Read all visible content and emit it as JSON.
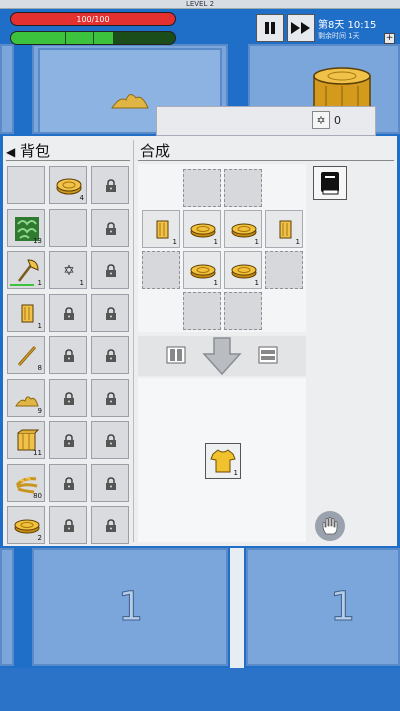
{
  "hud": {
    "level_label": "LEVEL 2",
    "hp_text": "100/100",
    "hp_fraction": 1.0,
    "stamina_fraction": 0.62,
    "day_text": "第8天 10:15",
    "day_sub": "剩余时间 1天",
    "pause_icon": "pause-icon",
    "fast_forward_icon": "fast-forward-icon",
    "plus_label": "+"
  },
  "star_counter": {
    "icon": "star-of-david-icon",
    "value": "0"
  },
  "inventory": {
    "title": "背包",
    "back_icon": "triangle-left-icon",
    "slots": [
      {
        "item": "empty",
        "count": ""
      },
      {
        "item": "log-icon",
        "count": "4"
      },
      {
        "item": "lock-icon",
        "count": ""
      },
      {
        "item": "leaf-bush-icon",
        "count": "13"
      },
      {
        "item": "empty",
        "count": ""
      },
      {
        "item": "lock-icon",
        "count": ""
      },
      {
        "item": "axe-icon",
        "count": "1"
      },
      {
        "item": "star-icon",
        "count": "1"
      },
      {
        "item": "lock-icon",
        "count": ""
      },
      {
        "item": "plank-icon",
        "count": "1"
      },
      {
        "item": "lock-icon",
        "count": ""
      },
      {
        "item": "lock-icon",
        "count": ""
      },
      {
        "item": "stick-icon",
        "count": "8"
      },
      {
        "item": "lock-icon",
        "count": ""
      },
      {
        "item": "lock-icon",
        "count": ""
      },
      {
        "item": "sawdust-icon",
        "count": "9"
      },
      {
        "item": "lock-icon",
        "count": ""
      },
      {
        "item": "lock-icon",
        "count": ""
      },
      {
        "item": "crate-icon",
        "count": "11"
      },
      {
        "item": "lock-icon",
        "count": ""
      },
      {
        "item": "lock-icon",
        "count": ""
      },
      {
        "item": "wheat-icon",
        "count": "80"
      },
      {
        "item": "lock-icon",
        "count": ""
      },
      {
        "item": "lock-icon",
        "count": ""
      },
      {
        "item": "disc-icon",
        "count": "2"
      },
      {
        "item": "lock-icon",
        "count": ""
      },
      {
        "item": "lock-icon",
        "count": ""
      }
    ]
  },
  "crafting": {
    "title": "合成",
    "grid": [
      {
        "item": "empty-dashed",
        "count": ""
      },
      {
        "item": "empty-dashed",
        "count": ""
      },
      {
        "item": "plank-icon",
        "count": "1"
      },
      {
        "item": "disc-icon",
        "count": "1"
      },
      {
        "item": "disc-icon",
        "count": "1"
      },
      {
        "item": "plank-icon",
        "count": "1"
      },
      {
        "item": "empty-dashed",
        "count": ""
      },
      {
        "item": "disc-icon",
        "count": "1"
      },
      {
        "item": "disc-icon",
        "count": "1"
      },
      {
        "item": "empty-dashed",
        "count": ""
      },
      {
        "item": "empty-dashed",
        "count": ""
      },
      {
        "item": "empty-dashed",
        "count": ""
      }
    ],
    "result": {
      "item": "shirt-icon",
      "count": "1"
    },
    "recipe_book_icon": "book-icon",
    "hand_icon": "hand-icon"
  },
  "world": {
    "left_number": "1",
    "right_number": "1"
  },
  "colors": {
    "hp": "#e53030",
    "stamina": "#3cc23c",
    "sky": "#1f6fc9",
    "wood": "#d9a62a"
  }
}
